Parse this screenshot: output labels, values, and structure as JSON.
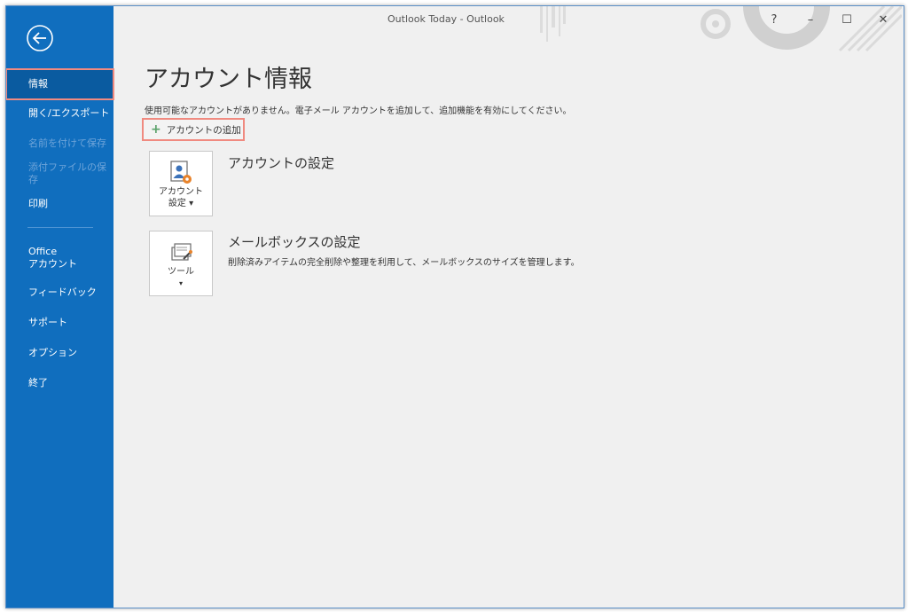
{
  "window": {
    "title": "Outlook Today  -  Outlook",
    "help_label": "?",
    "minimize_label": "–",
    "maximize_label": "☐",
    "close_label": "✕"
  },
  "sidebar": {
    "back_icon": "back-arrow-icon",
    "items": [
      {
        "label": "情報",
        "state": "selected"
      },
      {
        "label": "開く/エクスポート",
        "state": "normal"
      },
      {
        "label": "名前を付けて保存",
        "state": "disabled"
      },
      {
        "label": "添付ファイルの保存",
        "state": "disabled"
      },
      {
        "label": "印刷",
        "state": "normal"
      },
      {
        "label": "Office\nアカウント",
        "state": "normal"
      },
      {
        "label": "フィードバック",
        "state": "normal"
      },
      {
        "label": "サポート",
        "state": "normal"
      },
      {
        "label": "オプション",
        "state": "normal"
      },
      {
        "label": "終了",
        "state": "normal"
      }
    ]
  },
  "main": {
    "title": "アカウント情報",
    "info": "使用可能なアカウントがありません。電子メール アカウントを追加して、追加機能を有効にしてください。",
    "add_account_label": "アカウントの追加",
    "account_settings": {
      "tile_label_line1": "アカウント",
      "tile_label_line2": "設定 ▾",
      "title": "アカウントの設定"
    },
    "mailbox_settings": {
      "tile_label": "ツール",
      "tile_dropdown": "▾",
      "title": "メールボックスの設定",
      "description": "削除済みアイテムの完全削除や整理を利用して、メールボックスのサイズを管理します。"
    }
  },
  "colors": {
    "sidebar": "#106ebe",
    "highlight": "#f08a80",
    "background": "#f0f0f0"
  }
}
